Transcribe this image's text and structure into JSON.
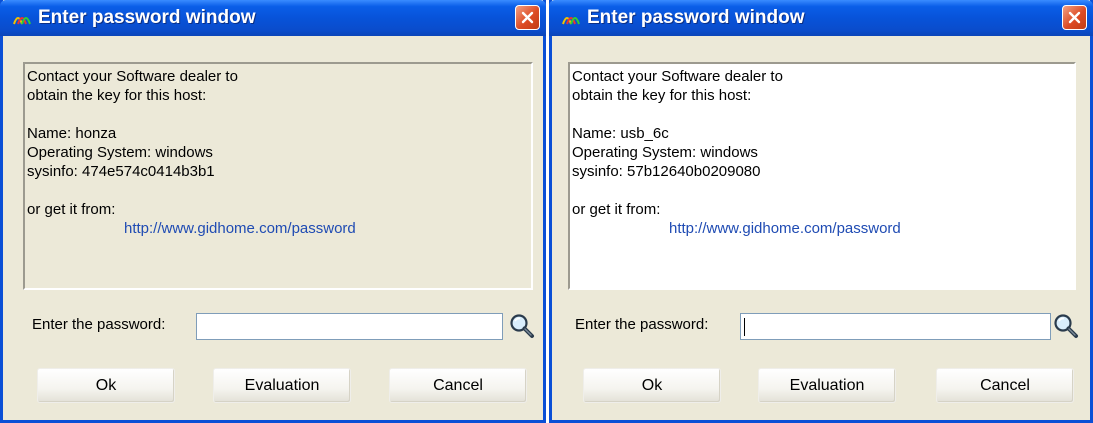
{
  "windows": [
    {
      "title": "Enter password window",
      "lines": [
        "Contact your Software dealer to",
        "obtain the key for this host:",
        "",
        "Name: honza",
        "Operating System: windows",
        "sysinfo: 474e574c0414b3b1",
        "",
        "or get it from:"
      ],
      "link": "http://www.gidhome.com/password",
      "password_label": "Enter the password:",
      "password_value": "",
      "buttons": {
        "ok": "Ok",
        "evaluation": "Evaluation",
        "cancel": "Cancel"
      }
    },
    {
      "title": "Enter password window",
      "lines": [
        "Contact your Software dealer to",
        "obtain the key for this host:",
        "",
        "Name: usb_6c",
        "Operating System: windows",
        "sysinfo: 57b12640b0209080",
        "",
        "or get it from:"
      ],
      "link": "http://www.gidhome.com/password",
      "password_label": "Enter the password:",
      "password_value": "",
      "buttons": {
        "ok": "Ok",
        "evaluation": "Evaluation",
        "cancel": "Cancel"
      }
    }
  ],
  "icons": {
    "app": "app-logo-icon",
    "close": "close-icon",
    "search": "magnifier-icon"
  },
  "colors": {
    "titlebar": "#0853d9",
    "close": "#dd4b24",
    "link": "#1f4bb3",
    "dialog_bg": "#ece9d8"
  }
}
